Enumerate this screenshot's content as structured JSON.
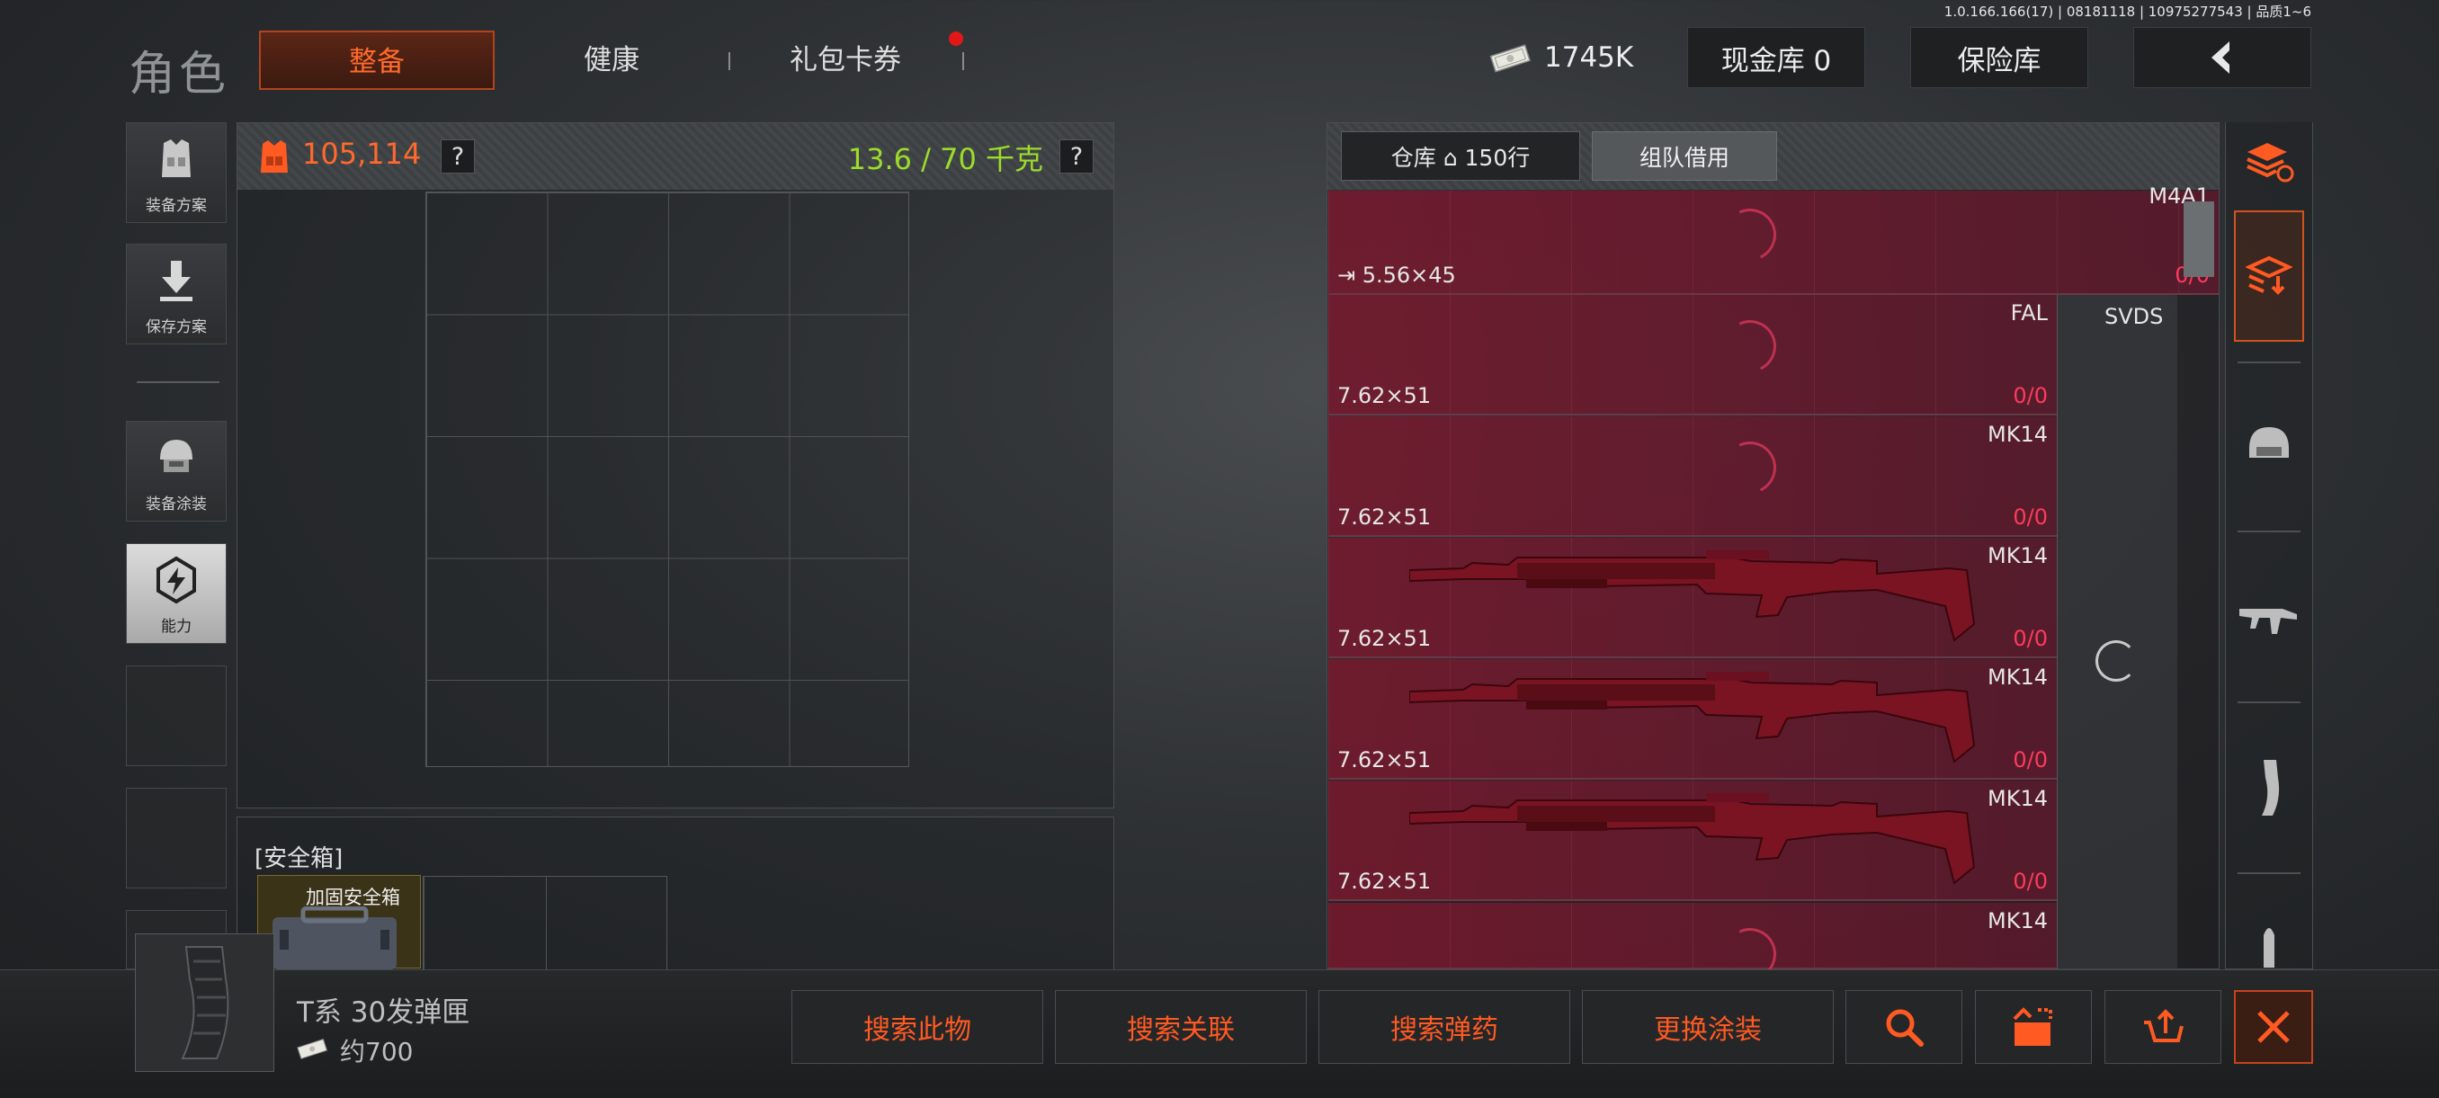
{
  "version": "1.0.166.166(17) | 08181118 | 10975277543 | 品质1~6",
  "header": {
    "title": "角色",
    "tabs": [
      {
        "label": "整备",
        "active": true
      },
      {
        "label": "健康",
        "active": false
      },
      {
        "label": "礼包卡券",
        "active": false,
        "notification": true
      }
    ],
    "money": "1745K",
    "cash_vault": "现金库 0",
    "insurance_vault": "保险库"
  },
  "left_menu": [
    {
      "label": "装备方案",
      "icon": "vest-icon"
    },
    {
      "label": "保存方案",
      "icon": "download-icon"
    },
    {
      "label": "装备涂装",
      "icon": "helmet-icon"
    },
    {
      "label": "能力",
      "icon": "ability-icon",
      "active": true
    }
  ],
  "backpack": {
    "value": "105,114",
    "help": "?",
    "weight": "13.6 / 70 千克"
  },
  "safe_box": {
    "label": "[安全箱]",
    "slot_label": "加固安全箱"
  },
  "warehouse": {
    "storage_tab": "仓库 ⌂ 150行",
    "team_tab": "组队借用",
    "rows": [
      {
        "caliber": "5.56×45",
        "name": "M4A1",
        "count_a": "0",
        "count_b": "0",
        "loading": true
      },
      {
        "caliber": "7.62×51",
        "name": "FAL",
        "count_a": "0",
        "count_b": "0",
        "loading": true
      },
      {
        "caliber": "7.62×51",
        "name": "MK14",
        "count_a": "0",
        "count_b": "0",
        "loading": true
      },
      {
        "caliber": "7.62×51",
        "name": "MK14",
        "count_a": "0",
        "count_b": "0",
        "loading": false
      },
      {
        "caliber": "7.62×51",
        "name": "MK14",
        "count_a": "0",
        "count_b": "0",
        "loading": false
      },
      {
        "caliber": "7.62×51",
        "name": "MK14",
        "count_a": "0",
        "count_b": "0",
        "loading": false
      },
      {
        "caliber": "",
        "name": "MK14",
        "count_a": "",
        "count_b": "",
        "loading": true
      }
    ],
    "side_item": "SVDS"
  },
  "categories": [
    "sort-icon",
    "backpack-import-icon",
    "helmet-icon",
    "rifle-icon",
    "magazine-icon",
    "ammo-icon"
  ],
  "selected_item": {
    "name": "T系 30发弹匣",
    "price": "约700"
  },
  "actions": [
    "搜索此物",
    "搜索关联",
    "搜索弹药",
    "更换涂装"
  ],
  "colors": {
    "accent": "#ff5a22",
    "weight": "#9bdc2a",
    "count": "#ff3a5a",
    "row_bg": "#7a1a30"
  }
}
